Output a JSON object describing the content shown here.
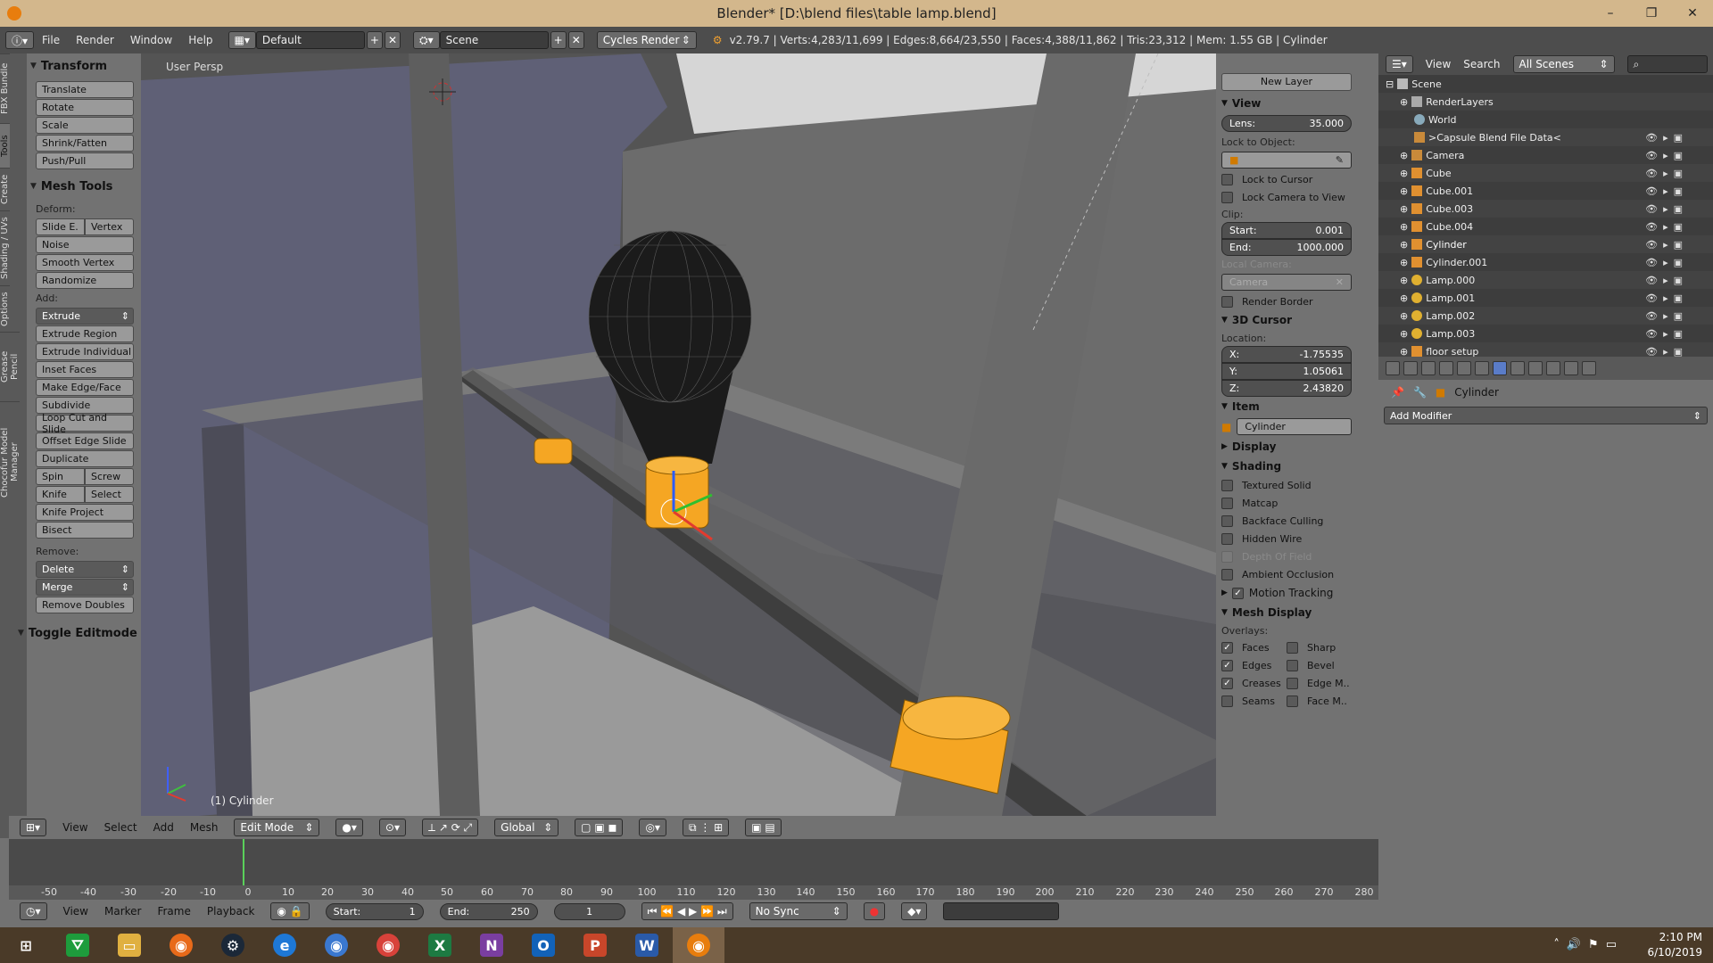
{
  "window": {
    "title": "Blender* [D:\\blend files\\table lamp.blend]",
    "controls": [
      "–",
      "❐",
      "✕"
    ]
  },
  "info_header": {
    "menus": [
      "File",
      "Render",
      "Window",
      "Help"
    ],
    "layout": "Default",
    "scene": "Scene",
    "engine": "Cycles Render",
    "stats": "v2.79.7 | Verts:4,283/11,699 | Edges:8,664/23,550 | Faces:4,388/11,862 | Tris:23,312 | Mem: 1.55 GB | Cylinder"
  },
  "tool_tabs": [
    "FBX Bundle",
    "Tools",
    "Create",
    "Shading / UVs",
    "Options",
    "Grease Pencil",
    "Chocofur Model Manager"
  ],
  "toolshelf": {
    "transform_title": "Transform",
    "transform": [
      "Translate",
      "Rotate",
      "Scale",
      "Shrink/Fatten",
      "Push/Pull"
    ],
    "mesh_tools_title": "Mesh Tools",
    "deform_label": "Deform:",
    "deform_pair": [
      "Slide E.",
      "Vertex"
    ],
    "deform": [
      "Noise",
      "Smooth Vertex",
      "Randomize"
    ],
    "add_label": "Add:",
    "extrude_dd": "Extrude",
    "add": [
      "Extrude Region",
      "Extrude Individual",
      "Inset Faces",
      "Make Edge/Face",
      "Subdivide",
      "Loop Cut and Slide",
      "Offset Edge Slide",
      "Duplicate"
    ],
    "pair2": [
      "Spin",
      "Screw"
    ],
    "pair3": [
      "Knife",
      "Select"
    ],
    "add2": [
      "Knife Project",
      "Bisect"
    ],
    "remove_label": "Remove:",
    "delete_dd": "Delete",
    "merge_dd": "Merge",
    "remove_doubles": "Remove Doubles",
    "toggle_editmode": "Toggle Editmode"
  },
  "viewport": {
    "label": "User Persp",
    "object_label": "(1) Cylinder"
  },
  "npanel": {
    "new_layer": "New Layer",
    "view_title": "View",
    "lens_label": "Lens:",
    "lens_value": "35.000",
    "lock_to_object": "Lock to Object:",
    "lock_to_cursor": "Lock to Cursor",
    "lock_camera": "Lock Camera to View",
    "clip_label": "Clip:",
    "clip_start_label": "Start:",
    "clip_start": "0.001",
    "clip_end_label": "End:",
    "clip_end": "1000.000",
    "local_camera": "Local Camera:",
    "camera": "Camera",
    "render_border": "Render Border",
    "cursor_title": "3D Cursor",
    "location_label": "Location:",
    "x_label": "X:",
    "x": "-1.75535",
    "y_label": "Y:",
    "y": "1.05061",
    "z_label": "Z:",
    "z": "2.43820",
    "item_title": "Item",
    "item_name": "Cylinder",
    "display_title": "Display",
    "shading_title": "Shading",
    "shading": [
      "Textured Solid",
      "Matcap",
      "Backface Culling",
      "Hidden Wire",
      "Depth Of Field",
      "Ambient Occlusion"
    ],
    "motion_tracking": "Motion Tracking",
    "mesh_display_title": "Mesh Display",
    "overlays_label": "Overlays:",
    "overlays_left": [
      "Faces",
      "Edges",
      "Creases",
      "Seams"
    ],
    "overlays_right": [
      "Sharp",
      "Bevel",
      "Edge M..",
      "Face M.."
    ]
  },
  "outliner": {
    "header": [
      "View",
      "Search"
    ],
    "filter": "All Scenes",
    "rows": [
      "Scene",
      "RenderLayers",
      "World",
      ">Capsule Blend File Data<",
      "Camera",
      "Cube",
      "Cube.001",
      "Cube.003",
      "Cube.004",
      "Cylinder",
      "Cylinder.001",
      "Lamp.000",
      "Lamp.001",
      "Lamp.002",
      "Lamp.003",
      "floor setup"
    ]
  },
  "properties": {
    "object": "Cylinder",
    "add_modifier": "Add Modifier"
  },
  "viewport_header": {
    "menus": [
      "View",
      "Select",
      "Add",
      "Mesh"
    ],
    "mode": "Edit Mode",
    "orientation": "Global"
  },
  "timeline": {
    "ticks": [
      "-50",
      "-40",
      "-30",
      "-20",
      "-10",
      "0",
      "10",
      "20",
      "30",
      "40",
      "50",
      "60",
      "70",
      "80",
      "90",
      "100",
      "110",
      "120",
      "130",
      "140",
      "150",
      "160",
      "170",
      "180",
      "190",
      "200",
      "210",
      "220",
      "230",
      "240",
      "250",
      "260",
      "270",
      "280"
    ],
    "menus": [
      "View",
      "Marker",
      "Frame",
      "Playback"
    ],
    "start_label": "Start:",
    "start": "1",
    "end_label": "End:",
    "end": "250",
    "current": "1",
    "sync": "No Sync"
  },
  "taskbar": {
    "time": "2:10 PM",
    "date": "6/10/2019"
  },
  "colors": {
    "selection": "#f5a623",
    "bulb": "#1a1a1a",
    "floor": "#9a9a9a"
  }
}
